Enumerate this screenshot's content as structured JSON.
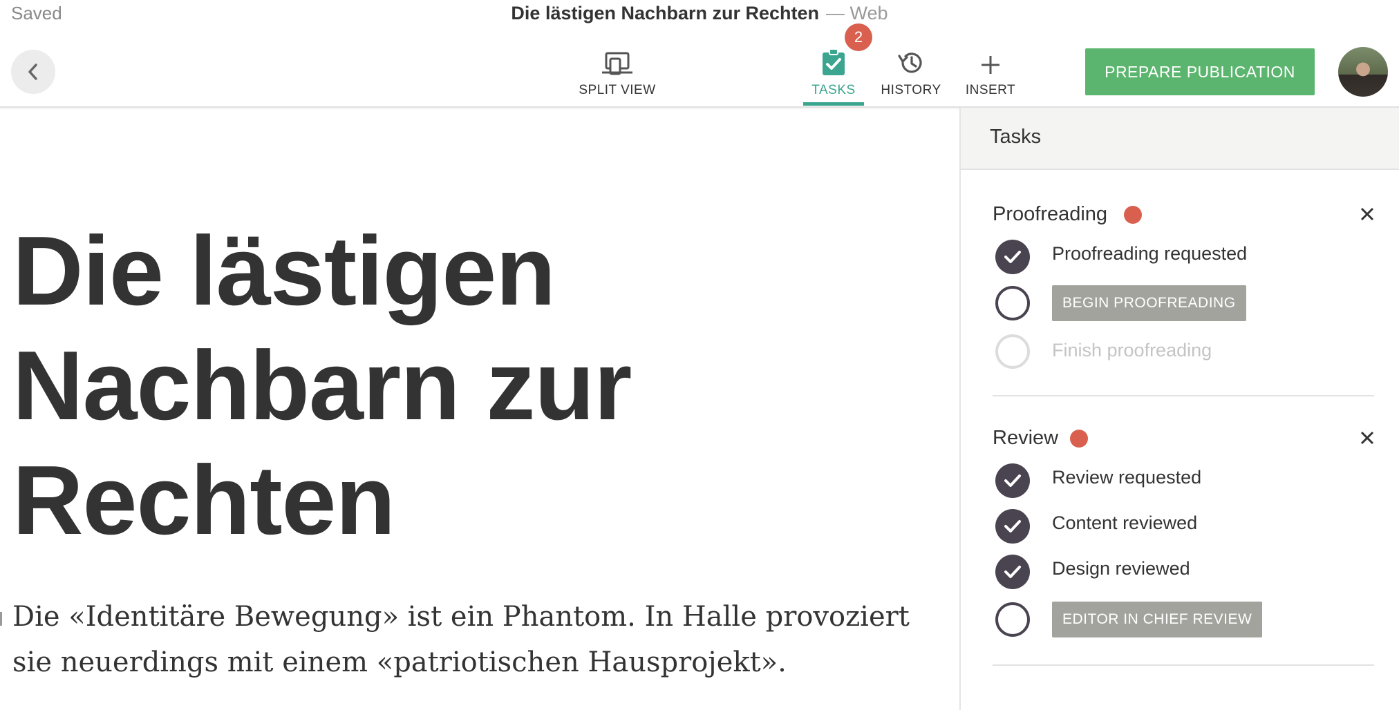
{
  "header": {
    "save_status": "Saved",
    "document_title": "Die lästigen Nachbarn zur Rechten",
    "channel": "— Web",
    "tasks_badge_count": "2",
    "toolbar": [
      {
        "id": "split-view",
        "label": "SPLIT VIEW",
        "icon": "split-view-icon"
      },
      {
        "id": "tasks",
        "label": "TASKS",
        "icon": "tasks-clipboard-icon",
        "active": true
      },
      {
        "id": "history",
        "label": "HISTORY",
        "icon": "history-icon"
      },
      {
        "id": "insert",
        "label": "INSERT",
        "icon": "plus-icon"
      }
    ],
    "publish_label": "PREPARE PUBLICATION",
    "back_icon": "chevron-left-icon",
    "avatar": "user-avatar"
  },
  "editor": {
    "headline": "Die lästigen Nachbarn zur Rechten",
    "lead": "Die «Identitäre Bewegung» ist ein Phantom. In Halle provoziert sie neuerdings mit einem «patriotischen Hausprojekt»."
  },
  "sidebar": {
    "title": "Tasks",
    "groups": [
      {
        "title": "Proofreading",
        "tasks": [
          {
            "label": "Proofreading requested",
            "state": "done"
          },
          {
            "label": "BEGIN PROOFREADING",
            "state": "open-action"
          },
          {
            "label": "Finish proofreading",
            "state": "disabled"
          }
        ]
      },
      {
        "title": "Review",
        "tasks": [
          {
            "label": "Review requested",
            "state": "done"
          },
          {
            "label": "Content reviewed",
            "state": "done"
          },
          {
            "label": "Design reviewed",
            "state": "done"
          },
          {
            "label": "EDITOR IN CHIEF REVIEW",
            "state": "open-action"
          }
        ]
      }
    ]
  },
  "colors": {
    "accent_green": "#3ba58f",
    "publish_green": "#5cb56f",
    "status_red": "#d9604f",
    "check_dark": "#4a4350",
    "action_gray": "#a3a39e"
  }
}
